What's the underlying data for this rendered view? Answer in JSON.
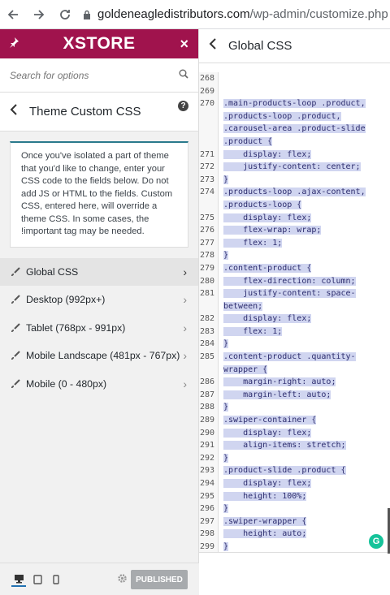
{
  "browser": {
    "url_domain": "goldeneagledistributors.com",
    "url_path": "/wp-admin/customize.php"
  },
  "brand": {
    "logo": "XSTORE"
  },
  "search": {
    "placeholder": "Search for options"
  },
  "section": {
    "title": "Theme Custom CSS",
    "description": "Once you've isolated a part of theme that you'd like to change, enter your CSS code to the fields below. Do not add JS or HTML to the fields. Custom CSS, entered here, will override a theme CSS. In some cases, the !important tag may be needed."
  },
  "menu": [
    {
      "label": "Global CSS"
    },
    {
      "label": "Desktop (992px+)"
    },
    {
      "label": "Tablet (768px - 991px)"
    },
    {
      "label": "Mobile Landscape (481px - 767px)"
    },
    {
      "label": "Mobile (0 - 480px)"
    }
  ],
  "footer": {
    "published_label": "PUBLISHED"
  },
  "editor": {
    "title": "Global CSS",
    "lines": [
      {
        "n": "268",
        "t": ""
      },
      {
        "n": "269",
        "t": ""
      },
      {
        "n": "270",
        "t": ".main-products-loop .product,"
      },
      {
        "n": "",
        "t": ".products-loop .product,"
      },
      {
        "n": "",
        "t": ".carousel-area .product-slide"
      },
      {
        "n": "",
        "t": ".product {"
      },
      {
        "n": "271",
        "t": "    display: flex;"
      },
      {
        "n": "272",
        "t": "    justify-content: center;"
      },
      {
        "n": "273",
        "t": "}"
      },
      {
        "n": "274",
        "t": ".products-loop .ajax-content,"
      },
      {
        "n": "",
        "t": ".products-loop {"
      },
      {
        "n": "275",
        "t": "    display: flex;"
      },
      {
        "n": "276",
        "t": "    flex-wrap: wrap;"
      },
      {
        "n": "277",
        "t": "    flex: 1;"
      },
      {
        "n": "278",
        "t": "}"
      },
      {
        "n": "279",
        "t": ".content-product {"
      },
      {
        "n": "280",
        "t": "    flex-direction: column;"
      },
      {
        "n": "281",
        "t": "    justify-content: space-"
      },
      {
        "n": "",
        "t": "between;"
      },
      {
        "n": "282",
        "t": "    display: flex;"
      },
      {
        "n": "283",
        "t": "    flex: 1;"
      },
      {
        "n": "284",
        "t": "}"
      },
      {
        "n": "285",
        "t": ".content-product .quantity-"
      },
      {
        "n": "",
        "t": "wrapper {"
      },
      {
        "n": "286",
        "t": "    margin-right: auto;"
      },
      {
        "n": "287",
        "t": "    margin-left: auto;"
      },
      {
        "n": "288",
        "t": "}"
      },
      {
        "n": "289",
        "t": ".swiper-container {"
      },
      {
        "n": "290",
        "t": "    display: flex;"
      },
      {
        "n": "291",
        "t": "    align-items: stretch;"
      },
      {
        "n": "292",
        "t": "}"
      },
      {
        "n": "293",
        "t": ".product-slide .product {"
      },
      {
        "n": "294",
        "t": "    display: flex;"
      },
      {
        "n": "295",
        "t": "    height: 100%;"
      },
      {
        "n": "296",
        "t": "}"
      },
      {
        "n": "297",
        "t": ".swiper-wrapper {"
      },
      {
        "n": "298",
        "t": "    height: auto;"
      },
      {
        "n": "299",
        "t": "}"
      }
    ]
  },
  "colors": {
    "brand": "#a0134d",
    "selection": "#d0d5f0",
    "grammarly": "#15c39a"
  }
}
